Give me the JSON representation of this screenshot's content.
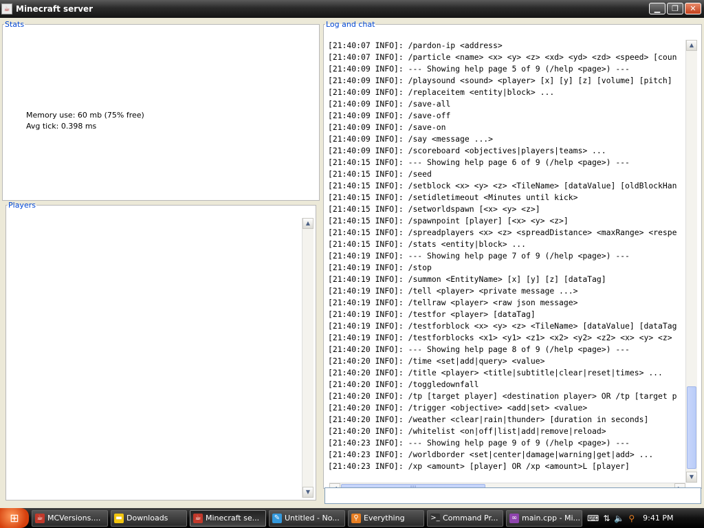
{
  "window": {
    "title": "Minecraft server",
    "icon": "java-icon",
    "buttons": [
      "minimize",
      "maximize",
      "close"
    ]
  },
  "stats": {
    "legend": "Stats",
    "memory": "Memory use: 60 mb (75% free)",
    "avg_tick": "Avg tick: 0.398 ms"
  },
  "players": {
    "legend": "Players"
  },
  "log": {
    "legend": "Log and chat",
    "lines": [
      "[21:40:07 INFO]: /pardon-ip <address>",
      "[21:40:07 INFO]: /particle <name> <x> <y> <z> <xd> <yd> <zd> <speed> [coun",
      "[21:40:09 INFO]: --- Showing help page 5 of 9 (/help <page>) ---",
      "[21:40:09 INFO]: /playsound <sound> <player> [x] [y] [z] [volume] [pitch]",
      "[21:40:09 INFO]: /replaceitem <entity|block> ...",
      "[21:40:09 INFO]: /save-all",
      "[21:40:09 INFO]: /save-off",
      "[21:40:09 INFO]: /save-on",
      "[21:40:09 INFO]: /say <message ...>",
      "[21:40:09 INFO]: /scoreboard <objectives|players|teams> ...",
      "[21:40:15 INFO]: --- Showing help page 6 of 9 (/help <page>) ---",
      "[21:40:15 INFO]: /seed",
      "[21:40:15 INFO]: /setblock <x> <y> <z> <TileName> [dataValue] [oldBlockHan",
      "[21:40:15 INFO]: /setidletimeout <Minutes until kick>",
      "[21:40:15 INFO]: /setworldspawn [<x> <y> <z>]",
      "[21:40:15 INFO]: /spawnpoint [player] [<x> <y> <z>]",
      "[21:40:15 INFO]: /spreadplayers <x> <z> <spreadDistance> <maxRange> <respe",
      "[21:40:15 INFO]: /stats <entity|block> ...",
      "[21:40:19 INFO]: --- Showing help page 7 of 9 (/help <page>) ---",
      "[21:40:19 INFO]: /stop",
      "[21:40:19 INFO]: /summon <EntityName> [x] [y] [z] [dataTag]",
      "[21:40:19 INFO]: /tell <player> <private message ...>",
      "[21:40:19 INFO]: /tellraw <player> <raw json message>",
      "[21:40:19 INFO]: /testfor <player> [dataTag]",
      "[21:40:19 INFO]: /testforblock <x> <y> <z> <TileName> [dataValue] [dataTag",
      "[21:40:19 INFO]: /testforblocks <x1> <y1> <z1> <x2> <y2> <z2> <x> <y> <z>",
      "[21:40:20 INFO]: --- Showing help page 8 of 9 (/help <page>) ---",
      "[21:40:20 INFO]: /time <set|add|query> <value>",
      "[21:40:20 INFO]: /title <player> <title|subtitle|clear|reset|times> ...",
      "[21:40:20 INFO]: /toggledownfall",
      "[21:40:20 INFO]: /tp [target player] <destination player> OR /tp [target p",
      "[21:40:20 INFO]: /trigger <objective> <add|set> <value>",
      "[21:40:20 INFO]: /weather <clear|rain|thunder> [duration in seconds]",
      "[21:40:20 INFO]: /whitelist <on|off|list|add|remove|reload>",
      "[21:40:23 INFO]: --- Showing help page 9 of 9 (/help <page>) ---",
      "[21:40:23 INFO]: /worldborder <set|center|damage|warning|get|add> ...",
      "[21:40:23 INFO]: /xp <amount> [player] OR /xp <amount>L [player]"
    ],
    "input_value": ""
  },
  "taskbar": {
    "tasks": [
      {
        "label": "MCVersions....",
        "icon": "java-icon",
        "color": "#c0392b"
      },
      {
        "label": "Downloads",
        "icon": "folder-icon",
        "color": "#f1c40f"
      },
      {
        "label": "Minecraft se...",
        "icon": "java-icon",
        "color": "#c0392b"
      },
      {
        "label": "Untitled - No...",
        "icon": "notepad-icon",
        "color": "#3498db"
      },
      {
        "label": "Everything",
        "icon": "search-icon",
        "color": "#e67e22"
      },
      {
        "label": "Command Pr...",
        "icon": "cmd-icon",
        "color": "#333333"
      },
      {
        "label": "main.cpp - Mi...",
        "icon": "visual-studio-icon",
        "color": "#8e44ad"
      }
    ],
    "clock": "9:41 PM"
  }
}
